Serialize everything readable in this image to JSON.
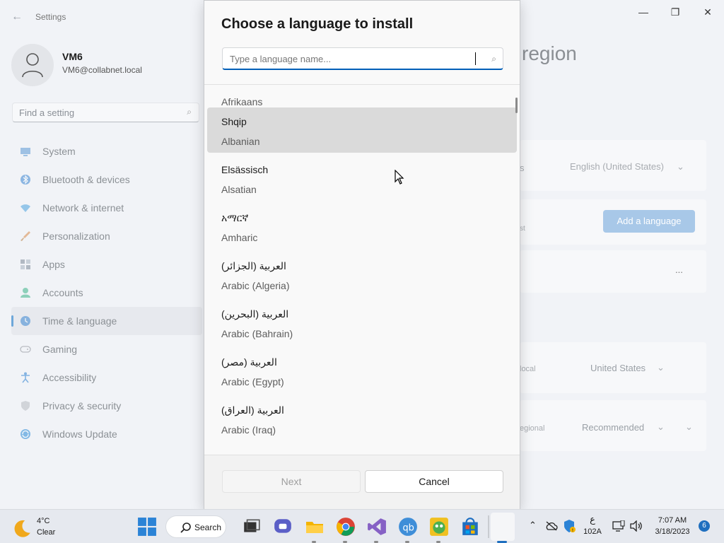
{
  "settings": {
    "app_title": "Settings",
    "user": {
      "name": "VM6",
      "email": "VM6@collabnet.local"
    },
    "search_placeholder": "Find a setting",
    "nav": [
      {
        "label": "System",
        "icon": "monitor-icon",
        "color": "#5c9ad6"
      },
      {
        "label": "Bluetooth & devices",
        "icon": "bluetooth-icon",
        "color": "#3a86d1"
      },
      {
        "label": "Network & internet",
        "icon": "wifi-icon",
        "color": "#4aa3df"
      },
      {
        "label": "Personalization",
        "icon": "brush-icon",
        "color": "#d98b4a"
      },
      {
        "label": "Apps",
        "icon": "apps-icon",
        "color": "#7e8a9a"
      },
      {
        "label": "Accounts",
        "icon": "person-icon",
        "color": "#3cb48a"
      },
      {
        "label": "Time & language",
        "icon": "globe-clock-icon",
        "color": "#3a86d1",
        "active": true
      },
      {
        "label": "Gaming",
        "icon": "gamepad-icon",
        "color": "#8a8f96"
      },
      {
        "label": "Accessibility",
        "icon": "accessibility-icon",
        "color": "#2a7fd1"
      },
      {
        "label": "Privacy & security",
        "icon": "shield-icon",
        "color": "#8a8f96"
      },
      {
        "label": "Windows Update",
        "icon": "update-icon",
        "color": "#2a8ad8"
      }
    ],
    "page_title_fragment": "region",
    "background": {
      "display_language_value": "English (United States)",
      "add_language_label": "Add a language",
      "more_label": "...",
      "country_value": "United States",
      "regional_format_value": "Recommended",
      "country_fragment": "local",
      "regional_fragment": "egional",
      "preferred_fragment": "st",
      "display_fragment": "s"
    },
    "window_controls": {
      "minimize": "—",
      "maximize": "❐",
      "close": "✕"
    }
  },
  "dialog": {
    "title": "Choose a language to install",
    "search_placeholder": "Type a language name...",
    "languages": [
      {
        "native": "",
        "english": "Afrikaans"
      },
      {
        "native": "Shqip",
        "english": "Albanian",
        "selected": true
      },
      {
        "native": "Elsässisch",
        "english": "Alsatian"
      },
      {
        "native": "አማርኛ",
        "english": "Amharic"
      },
      {
        "native": "العربية (الجزائر)",
        "english": "Arabic (Algeria)"
      },
      {
        "native": "العربية (البحرين)",
        "english": "Arabic (Bahrain)"
      },
      {
        "native": "العربية (مصر)",
        "english": "Arabic (Egypt)"
      },
      {
        "native": "العربية (العراق)",
        "english": "Arabic (Iraq)"
      }
    ],
    "next_label": "Next",
    "cancel_label": "Cancel"
  },
  "taskbar": {
    "weather_temp": "4°C",
    "weather_condition": "Clear",
    "search_label": "Search",
    "input_indicator_top": "ع",
    "input_indicator_bottom": "102A",
    "time": "7:07 AM",
    "date": "3/18/2023",
    "notification_count": "6"
  }
}
